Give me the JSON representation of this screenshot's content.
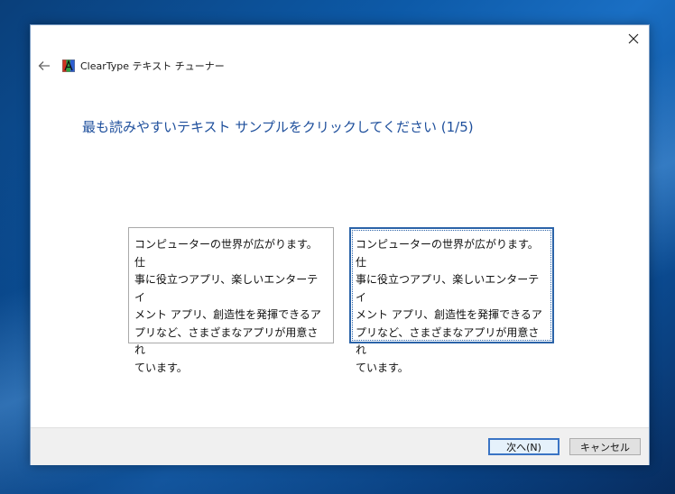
{
  "window": {
    "title": "ClearType テキスト チューナー"
  },
  "instruction": {
    "heading": "最も読みやすいテキスト サンプルをクリックしてください (1/5)"
  },
  "samples": [
    {
      "lines": [
        "コンピューターの世界が広がります。仕",
        "事に役立つアプリ、楽しいエンターテイ",
        "メント アプリ、創造性を発揮できるア",
        "プリなど、さまざまなアプリが用意され",
        "ています。"
      ],
      "selected": false
    },
    {
      "lines": [
        "コンピューターの世界が広がります。仕",
        "事に役立つアプリ、楽しいエンターテイ",
        "メント アプリ、創造性を発揮できるア",
        "プリなど、さまざまなアプリが用意され",
        "ています。"
      ],
      "selected": true
    }
  ],
  "footer": {
    "next_label": "次へ(N)",
    "cancel_label": "キャンセル"
  },
  "icons": {
    "close": "close-icon",
    "back": "back-arrow-icon",
    "app": "cleartype-app-icon"
  },
  "colors": {
    "heading": "#1e4f9c",
    "selection_border": "#2b63a8"
  }
}
